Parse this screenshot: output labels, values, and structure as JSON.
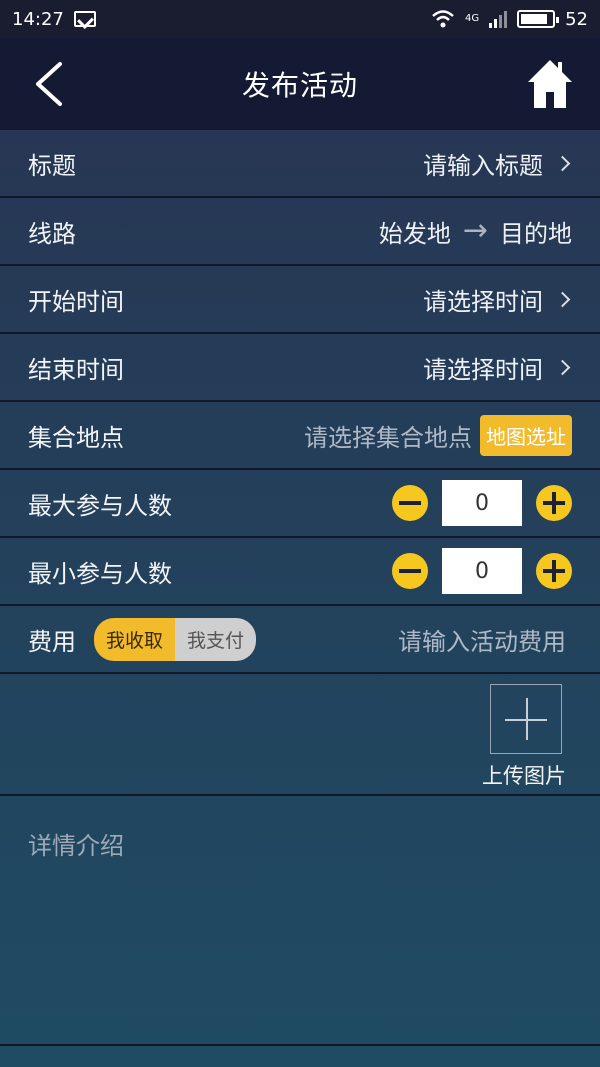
{
  "status_bar": {
    "time": "14:27",
    "signal_type": "4G",
    "battery": "52"
  },
  "nav": {
    "title": "发布活动",
    "back_icon": "chevron-left-icon",
    "home_icon": "home-icon"
  },
  "form": {
    "title_row": {
      "label": "标题",
      "placeholder": "请输入标题"
    },
    "route_row": {
      "label": "线路",
      "from": "始发地",
      "arrow": "→",
      "to": "目的地"
    },
    "start_row": {
      "label": "开始时间",
      "placeholder": "请选择时间"
    },
    "end_row": {
      "label": "结束时间",
      "placeholder": "请选择时间"
    },
    "meet_row": {
      "label": "集合地点",
      "placeholder": "请选择集合地点",
      "map_button": "地图选址"
    },
    "max_row": {
      "label": "最大参与人数",
      "value": "0"
    },
    "min_row": {
      "label": "最小参与人数",
      "value": "0"
    },
    "fee_row": {
      "label": "费用",
      "option_receive": "我收取",
      "option_pay": "我支付",
      "placeholder": "请输入活动费用"
    },
    "upload": {
      "label": "上传图片"
    },
    "detail": {
      "placeholder": "详情介绍"
    }
  },
  "colors": {
    "accent": "#f2bb2b",
    "nav_bg": "#141a33",
    "status_bg": "#1a1d30"
  }
}
